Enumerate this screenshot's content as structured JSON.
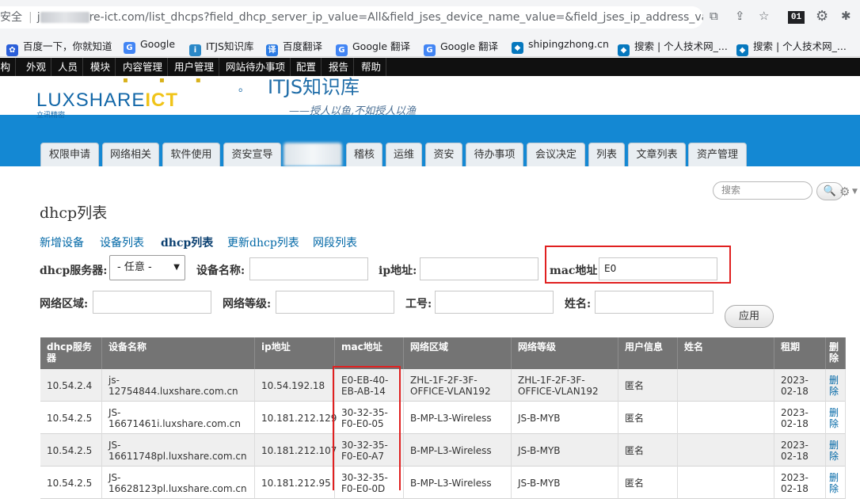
{
  "browser": {
    "insecure_label": "安全",
    "url_prefix": "j",
    "url_rest": "re-ict.com/list_dhcps?field_dhcp_server_ip_value=All&field_jses_device_name_value=&field_jses_ip_address_val...",
    "ext_label": "01"
  },
  "bookmarks": [
    {
      "label": "百度一下，你就知道",
      "color": "#2b5fd9",
      "glyph": "✿"
    },
    {
      "label": "Google",
      "color": "#4285f4",
      "glyph": "G"
    },
    {
      "label": "ITJS知识库",
      "color": "#2a88c8",
      "glyph": "i"
    },
    {
      "label": "百度翻译",
      "color": "#2b7be4",
      "glyph": "译"
    },
    {
      "label": "Google 翻译",
      "color": "#4285f4",
      "glyph": "G"
    },
    {
      "label": "Google 翻译",
      "color": "#4285f4",
      "glyph": "G"
    },
    {
      "label": "shipingzhong.cn",
      "color": "#0678be",
      "glyph": "◆"
    },
    {
      "label": "搜索 | 个人技术网_...",
      "color": "#0678be",
      "glyph": "◆"
    },
    {
      "label": "搜索 | 个人技术网_...",
      "color": "#0678be",
      "glyph": "◆"
    }
  ],
  "admin_menu": [
    "结构",
    "外观",
    "人员",
    "模块",
    "内容管理",
    "用户管理",
    "网站待办事项",
    "配置",
    "报告",
    "帮助"
  ],
  "site": {
    "logo_word": "LUXSHARE",
    "logo_ict": "ICT",
    "logo_sub": "立讯精密",
    "title": "ITJS知识库",
    "slogan": "——授人以鱼,不如授人以渔"
  },
  "tabs": [
    "权限申请",
    "网络相关",
    "软件使用",
    "资安宣导",
    "",
    "稽核",
    "运维",
    "资安",
    "待办事项",
    "会议决定",
    "列表",
    "文章列表",
    "资产管理"
  ],
  "search": {
    "placeholder": "搜索",
    "icon_label": "🔍"
  },
  "page": {
    "title": "dhcp列表",
    "sub_links": [
      "新增设备",
      "设备列表",
      "dhcp列表",
      "更新dhcp列表",
      "网段列表"
    ]
  },
  "filters": {
    "dhcp_server_label": "dhcp服务器:",
    "dhcp_server_value": "- 任意 -",
    "device_name_label": "设备名称:",
    "device_name_value": "",
    "ip_label": "ip地址:",
    "ip_value": "",
    "mac_label": "mac地址",
    "mac_value": "E0",
    "zone_label": "网络区域:",
    "zone_value": "",
    "level_label": "网络等级:",
    "level_value": "",
    "emp_label": "工号:",
    "emp_value": "",
    "name_label": "姓名:",
    "name_value": "",
    "apply_label": "应用"
  },
  "table": {
    "headers": [
      "dhcp服务器",
      "设备名称",
      "ip地址",
      "mac地址",
      "网络区域",
      "网络等级",
      "用户信息",
      "姓名",
      "租期",
      "删除"
    ],
    "rows": [
      [
        "10.54.2.4",
        "js-12754844.luxshare.com.cn",
        "10.54.192.18",
        "E0-EB-40-EB-AB-14",
        "ZHL-1F-2F-3F-OFFICE-VLAN192",
        "ZHL-1F-2F-3F-OFFICE-VLAN192",
        "匿名",
        "",
        "2023-02-18",
        "删除"
      ],
      [
        "10.54.2.5",
        "JS-16671461i.luxshare.com.cn",
        "10.181.212.129",
        "30-32-35-F0-E0-05",
        "B-MP-L3-Wireless",
        "JS-B-MYB",
        "匿名",
        "",
        "2023-02-18",
        "删除"
      ],
      [
        "10.54.2.5",
        "JS-16611748pl.luxshare.com.cn",
        "10.181.212.107",
        "30-32-35-F0-E0-A7",
        "B-MP-L3-Wireless",
        "JS-B-MYB",
        "匿名",
        "",
        "2023-02-18",
        "删除"
      ],
      [
        "10.54.2.5",
        "JS-16628123pl.luxshare.com.cn",
        "10.181.212.95",
        "30-32-35-F0-E0-0D",
        "B-MP-L3-Wireless",
        "JS-B-MYB",
        "匿名",
        "",
        "2023-02-18",
        "删除"
      ]
    ]
  }
}
